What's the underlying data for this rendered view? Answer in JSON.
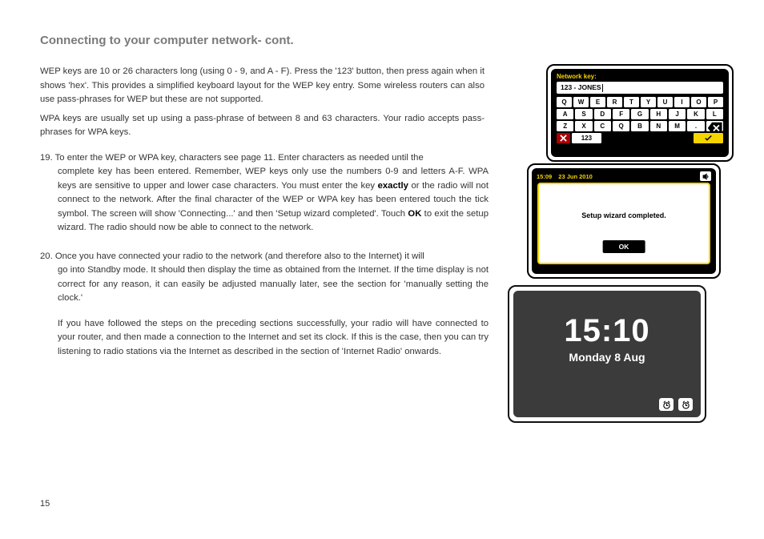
{
  "title": "Connecting to your computer network- cont.",
  "para1": "WEP keys are 10 or 26 characters long (using 0 - 9, and A - F). Press the '123' button, then press again when it shows 'hex'. This provides a simplified keyboard layout for the WEP key entry. Some wireless routers can also use pass-phrases for WEP but these are not supported.",
  "para2": "WPA keys are usually set up using a pass-phrase of between 8 and 63 characters. Your radio accepts pass-phrases for WPA keys.",
  "step19_num": "19.",
  "step19_a": "To enter the WEP or WPA key, characters see page 11. Enter characters as needed until the",
  "step19_b": "complete key has been entered. Remember, WEP keys only use the numbers 0-9 and letters A-F. WPA keys are sensitive to upper and lower case characters. You must enter the key ",
  "step19_exactly": "exactly",
  "step19_c": " or the radio will not connect to the network. After the final character of the WEP or WPA key has been entered touch the tick symbol. The screen will show 'Connecting...' and then 'Setup wizard completed'. Touch ",
  "step19_ok": "OK",
  "step19_d": " to exit the setup wizard. The radio should now be able to connect to the network.",
  "step20_num": "20.",
  "step20_a": "Once you have connected your radio to the network (and therefore also to the Internet) it will",
  "step20_b": "go into Standby mode. It should then display the time as obtained from the Internet. If the time display is not correct for any reason, it can easily be adjusted manually later, see the section for 'manually setting the clock.'",
  "step20_c": "If you have followed the steps on the preceding sections successfully, your radio will have connected to your router, and then made a connection to the Internet and set its clock. If this is the case, then you can try listening to radio stations via the Internet as described in the section of 'Internet Radio' onwards.",
  "pagenum": "15",
  "dev1": {
    "header": "Network key:",
    "value": "123 - JONES",
    "row1": [
      "Q",
      "W",
      "E",
      "R",
      "T",
      "Y",
      "U",
      "I",
      "O",
      "P"
    ],
    "row2": [
      "A",
      "S",
      "D",
      "F",
      "G",
      "H",
      "J",
      "K",
      "L"
    ],
    "row3": [
      "Z",
      "X",
      "C",
      "Q",
      "B",
      "N",
      "M",
      "."
    ],
    "mode": "123"
  },
  "dev2": {
    "time": "15:09",
    "date": "23 Jun 2010",
    "message": "Setup wizard completed.",
    "ok": "OK"
  },
  "dev3": {
    "time": "15:10",
    "date": "Monday 8 Aug"
  }
}
